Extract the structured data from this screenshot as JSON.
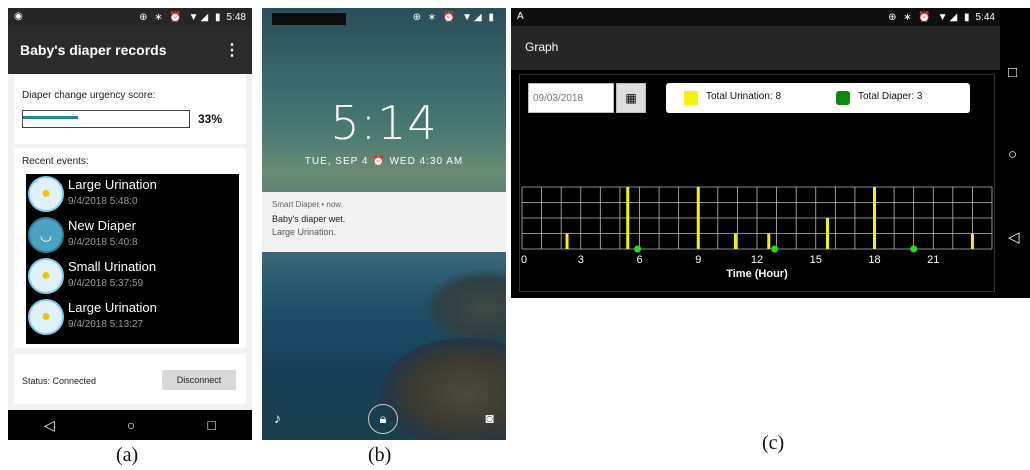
{
  "captions": {
    "a": "(a)",
    "b": "(b)",
    "c": "(c)"
  },
  "phone_a": {
    "status_time": "5:48",
    "status_icons": "⊕ ∗ ⏰ ▼◢ ▮",
    "title": "Baby's diaper records",
    "menu_icon": "⋮",
    "urgency_label": "Diaper change urgency score:",
    "urgency_percent": 33,
    "urgency_text": "33%",
    "recent_label": "Recent events:",
    "events": [
      {
        "title": "Large Urination",
        "time": "9/4/2018 5:48:0",
        "icon": "urination-icon"
      },
      {
        "title": "New Diaper",
        "time": "9/4/2018 5:40:8",
        "icon": "diaper-icon"
      },
      {
        "title": "Small Urination",
        "time": "9/4/2018 5:37:59",
        "icon": "urination-icon"
      },
      {
        "title": "Large Urination",
        "time": "9/4/2018 5:13:27",
        "icon": "urination-icon"
      }
    ],
    "status_text": "Status: Connected",
    "disconnect_label": "Disconnect",
    "nav": {
      "back": "◁",
      "home": "○",
      "recent": "□"
    }
  },
  "phone_b": {
    "status_icons": "⊕ ∗ ⏰ ▼◢ ▮",
    "clock": "5:14",
    "date": "TUE, SEP 4  ⏰ WED 4:30 AM",
    "notif_app": "Smart Diaper • now",
    "notif_title": "Baby's diaper wet.",
    "notif_body": "Large Urination."
  },
  "phone_c": {
    "status_left": "A",
    "status_time": "5:44",
    "status_icons": "⊕ ∗ ⏰ ▼◢ ▮",
    "title": "Graph",
    "date_value": "09/03/2018",
    "calendar_icon": "▦",
    "legend": [
      {
        "label": "Total Urination: 8",
        "color": "#f5f500"
      },
      {
        "label": "Total Diaper: 3",
        "color": "#0a8a0a"
      }
    ],
    "nav": {
      "recent": "□",
      "home": "○",
      "back": "◁"
    }
  },
  "chart_data": {
    "type": "bar",
    "title": "",
    "xlabel": "Time (Hour)",
    "ylabel": "",
    "xlim": [
      0,
      24
    ],
    "xticks": [
      0,
      3,
      6,
      9,
      12,
      15,
      18,
      21
    ],
    "grid": true,
    "ylim": [
      0,
      4
    ],
    "series": [
      {
        "name": "Total Urination",
        "color": "#f5f500",
        "kind": "bar",
        "x": [
          2.3,
          5.4,
          9.0,
          10.9,
          12.6,
          15.6,
          18.0,
          23.0
        ],
        "values": [
          1,
          4,
          4,
          1,
          1,
          2,
          4,
          1
        ]
      },
      {
        "name": "Total Diaper",
        "color": "#22dd22",
        "kind": "point",
        "x": [
          5.9,
          12.9,
          20.0
        ],
        "values": [
          0,
          0,
          0
        ]
      }
    ]
  }
}
